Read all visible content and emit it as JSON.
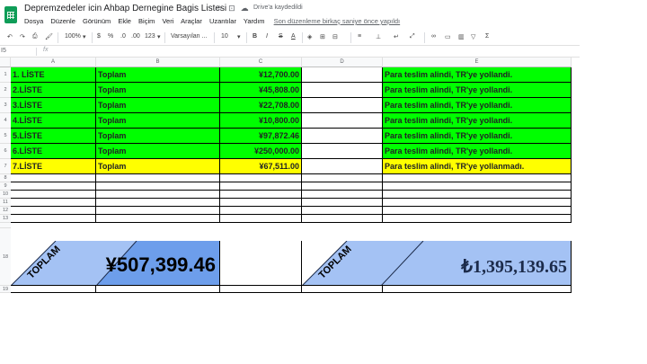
{
  "app": {
    "doc_title": "Depremzedeler icin Ahbap Dernegine Bagis Listesi",
    "saved_status": "Drive'a kaydedildi",
    "menu": [
      "Dosya",
      "Düzenle",
      "Görünüm",
      "Ekle",
      "Biçim",
      "Veri",
      "Araçlar",
      "Uzantılar",
      "Yardım"
    ],
    "last_edit": "Son düzenleme birkaç saniye önce yapıldı"
  },
  "toolbar": {
    "zoom": "100%",
    "currency": "$",
    "percent": "%",
    "decimal_less": ".0",
    "decimal_more": ".00",
    "format_more": "123",
    "font": "Varsayılan ...",
    "font_size": "10",
    "bold": "B",
    "italic": "I",
    "strike": "S",
    "text_color": "A"
  },
  "formula_bar": {
    "name_box": "I5",
    "fx": "fx"
  },
  "columns": [
    "A",
    "B",
    "C",
    "D",
    "E"
  ],
  "row_numbers": [
    "1",
    "2",
    "3",
    "4",
    "5",
    "6",
    "7",
    "8",
    "9",
    "10",
    "11",
    "12",
    "13",
    "18",
    "19"
  ],
  "rows": [
    {
      "label": "1. LİSTE",
      "type": "Toplam",
      "amount": "¥12,700.00",
      "status": "Para teslim alindi, TR'ye yollandi.",
      "color": "#00ff00"
    },
    {
      "label": "2.LİSTE",
      "type": "Toplam",
      "amount": "¥45,808.00",
      "status": "Para teslim alindi, TR'ye yollandi.",
      "color": "#00ff00"
    },
    {
      "label": "3.LİSTE",
      "type": "Toplam",
      "amount": "¥22,708.00",
      "status": "Para teslim alindi, TR'ye yollandi.",
      "color": "#00ff00"
    },
    {
      "label": "4.LİSTE",
      "type": "Toplam",
      "amount": "¥10,800.00",
      "status": "Para teslim alindi, TR'ye yollandi.",
      "color": "#00ff00"
    },
    {
      "label": "5.LİSTE",
      "type": "Toplam",
      "amount": "¥97,872.46",
      "status": "Para teslim alindi, TR'ye yollandi.",
      "color": "#00ff00"
    },
    {
      "label": "6.LİSTE",
      "type": "Toplam",
      "amount": "¥250,000.00",
      "status": "Para teslim alindi, TR'ye yollandi.",
      "color": "#00ff00"
    },
    {
      "label": "7.LİSTE",
      "type": "Toplam",
      "amount": "¥67,511.00",
      "status": "Para teslim alindi, TR'ye yollanmadı.",
      "color": "#ffff00"
    }
  ],
  "totals": {
    "label_1": "TOPLAM",
    "value_yen": "¥507,399.46",
    "label_2": "TOPLAM",
    "value_lira": "₺1,395,139.65",
    "fill_color": "#a4c2f4",
    "dark_blue": "#1c2b4a"
  }
}
